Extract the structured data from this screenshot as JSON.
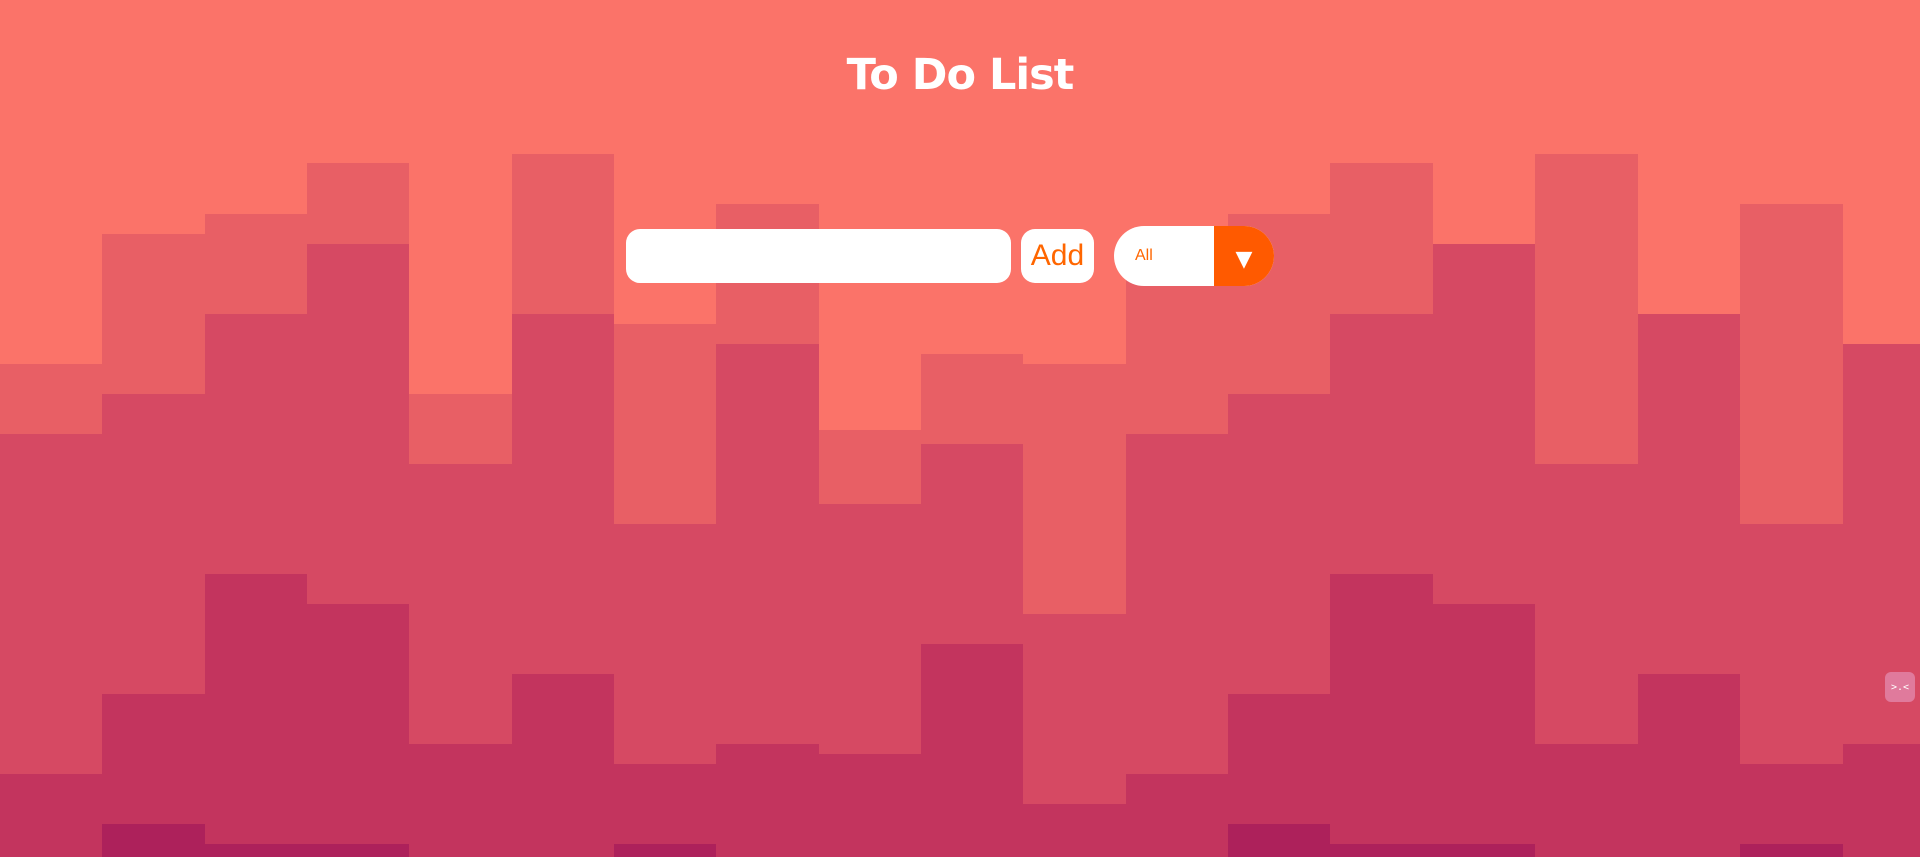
{
  "app": {
    "title": "To Do List"
  },
  "todo_form": {
    "input_value": "",
    "input_placeholder": "",
    "add_label": "Add"
  },
  "filter": {
    "selected": "All",
    "arrow_glyph": "▼",
    "options": [
      "All"
    ]
  },
  "side_widget": {
    "icon": "face-icon",
    "glyph": ">.<"
  },
  "colors": {
    "background": "#fb7369",
    "band_light": "#e85f65",
    "band_mid": "#d64963",
    "band_dark": "#c3345e",
    "band_darkest": "#ad215b",
    "accent": "#ff6600",
    "arrow_bg": "#ff5a00"
  }
}
